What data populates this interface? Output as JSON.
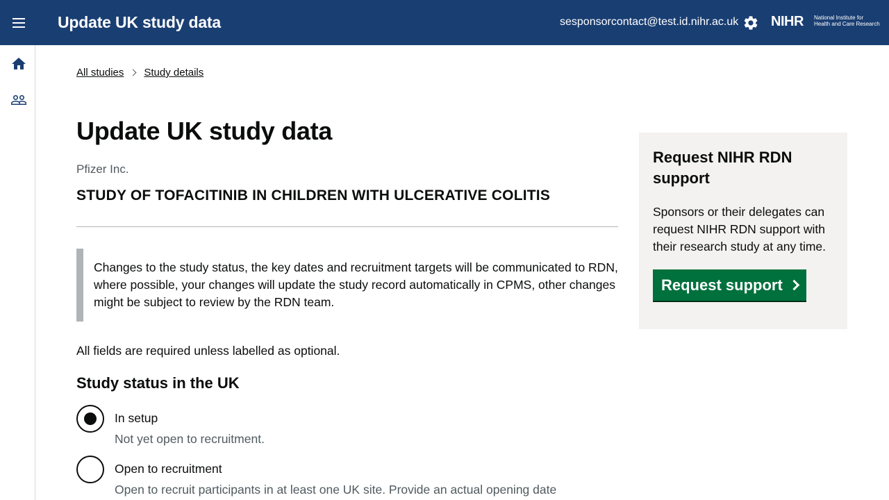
{
  "header": {
    "menu_icon": "hamburger-menu-icon",
    "app_title": "Update UK study data",
    "user_email": "sesponsorcontact@test.id.nihr.ac.uk",
    "settings_icon": "gear-icon",
    "logo_mark": "NIHR",
    "logo_subtitle_line1": "National Institute for",
    "logo_subtitle_line2": "Health and Care Research",
    "background_color": "#193e72"
  },
  "sidebar": {
    "items": [
      {
        "icon": "home-icon"
      },
      {
        "icon": "people-icon"
      }
    ]
  },
  "breadcrumb": {
    "items": [
      "All studies",
      "Study details"
    ]
  },
  "main": {
    "page_title": "Update UK study data",
    "organisation": "Pfizer Inc.",
    "study_title": "STUDY OF TOFACITINIB IN CHILDREN WITH ULCERATIVE COLITIS",
    "inset_text": "Changes to the study status, the key dates and recruitment targets will be communicated to RDN, where possible, your changes will update the study record automatically in CPMS, other changes might be subject to review by the RDN team.",
    "fields_note": "All fields are required unless labelled as optional.",
    "status_legend": "Study status in the UK",
    "status_options": [
      {
        "label": "In setup",
        "hint": "Not yet open to recruitment.",
        "checked": true
      },
      {
        "label": "Open to recruitment",
        "hint": "Open to recruit participants in at least one UK site. Provide an actual opening date",
        "checked": false
      }
    ]
  },
  "support_panel": {
    "title": "Request NIHR RDN support",
    "text": "Sponsors or their delegates can request NIHR RDN support with their research study at any time.",
    "button_label": "Request support",
    "button_color": "#00703c"
  }
}
